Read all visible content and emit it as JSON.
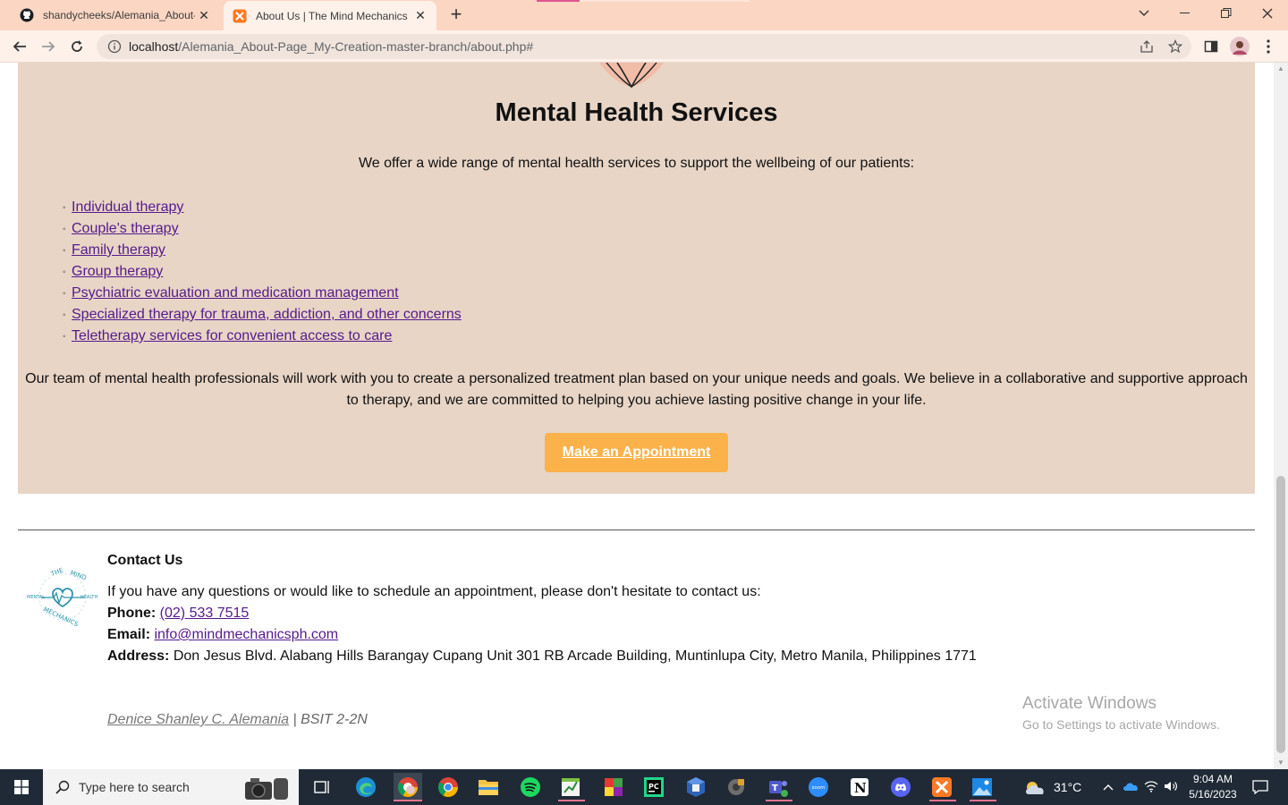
{
  "browser": {
    "tabs": [
      {
        "title": "shandycheeks/Alemania_About-P",
        "icon": "github-icon"
      },
      {
        "title": "About Us | The Mind Mechanics",
        "icon": "xampp-icon"
      }
    ],
    "url_host": "localhost",
    "url_path": "/Alemania_About-Page_My-Creation-master-branch/about.php#"
  },
  "services": {
    "title": "Mental Health Services",
    "intro": "We offer a wide range of mental health services to support the wellbeing of our patients:",
    "items": [
      "Individual therapy",
      "Couple's therapy",
      "Family therapy",
      "Group therapy",
      "Psychiatric evaluation and medication management",
      "Specialized therapy for trauma, addiction, and other concerns",
      "Teletherapy services for convenient access to care"
    ],
    "team_text": "Our team of mental health professionals will work with you to create a personalized treatment plan based on your unique needs and goals. We believe in a collaborative and supportive approach to therapy, and we are committed to helping you achieve lasting positive change in your life.",
    "button": "Make an Appointment"
  },
  "contact": {
    "heading": "Contact Us",
    "intro": "If you have any questions or would like to schedule an appointment, please don't hesitate to contact us:",
    "phone_label": "Phone:",
    "phone": "(02) 533 7515",
    "email_label": "Email:",
    "email": "info@mindmechanicsph.com",
    "address_label": "Address:",
    "address": "Don Jesus Blvd. Alabang Hills Barangay Cupang Unit 301 RB Arcade Building, Muntinlupa City, Metro Manila, Philippines 1771"
  },
  "credit": {
    "name": "Denice Shanley C. Alemania",
    "section": " | BSIT 2-2N"
  },
  "watermark": {
    "line1": "Activate Windows",
    "line2": "Go to Settings to activate Windows."
  },
  "taskbar": {
    "search_placeholder": "Type here to search",
    "temperature": "31°C",
    "time": "9:04 AM",
    "date": "5/16/2023"
  },
  "colors": {
    "tabbar": "#fbd6c3",
    "section_bg": "#e8d5c6",
    "button": "#fbb24a",
    "link": "#551a8b"
  }
}
